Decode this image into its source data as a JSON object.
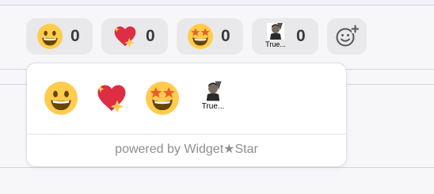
{
  "reactions": [
    {
      "icon": "grinning-face-icon",
      "count": "0"
    },
    {
      "icon": "sparkling-heart-icon",
      "count": "0"
    },
    {
      "icon": "star-struck-icon",
      "count": "0"
    },
    {
      "icon": "custom-avatar-icon",
      "caption": "True...",
      "count": "0"
    }
  ],
  "add_reaction": {
    "icon": "add-emoji-icon"
  },
  "picker": {
    "items": [
      {
        "icon": "grinning-face-icon"
      },
      {
        "icon": "sparkling-heart-icon"
      },
      {
        "icon": "star-struck-icon"
      },
      {
        "icon": "custom-avatar-icon",
        "caption": "True..."
      }
    ]
  },
  "footer": {
    "text": "powered by Widget★Star"
  },
  "colors": {
    "pill_bg": "#e9e9ec",
    "emoji_yellow": "#ffcc4d",
    "heart_red": "#dd2e44",
    "footer_text": "#8e8e93"
  }
}
